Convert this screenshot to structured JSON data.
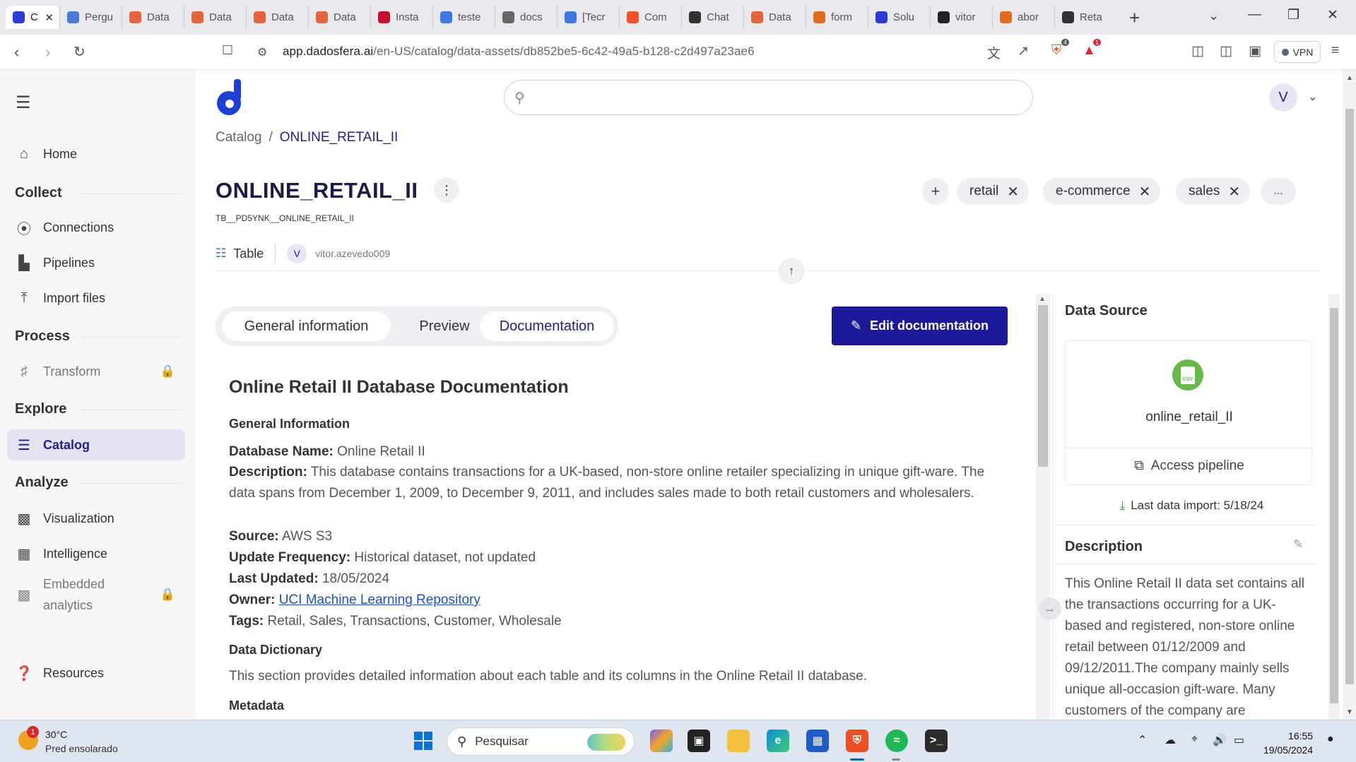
{
  "browser": {
    "tabs": [
      {
        "label": "C",
        "icon": "dadosfera-icon",
        "color": "#2c3bd6",
        "active": true
      },
      {
        "label": "Pergu",
        "icon": "doc-icon",
        "color": "#4a7bd8"
      },
      {
        "label": "Data",
        "icon": "g-icon",
        "color": "#e2633a"
      },
      {
        "label": "Data",
        "icon": "g-icon",
        "color": "#e2633a"
      },
      {
        "label": "Data",
        "icon": "g-icon",
        "color": "#e2633a"
      },
      {
        "label": "Data",
        "icon": "g-icon",
        "color": "#e2633a"
      },
      {
        "label": "Insta",
        "icon": "crown-icon",
        "color": "#c8102e"
      },
      {
        "label": "teste",
        "icon": "docs-icon",
        "color": "#3d78e0"
      },
      {
        "label": "docs",
        "icon": "globe-icon",
        "color": "#666666"
      },
      {
        "label": "[Tecr",
        "icon": "docs-icon",
        "color": "#3d78e0"
      },
      {
        "label": "Com",
        "icon": "windows-icon",
        "color": "#f25022"
      },
      {
        "label": "Chat",
        "icon": "openai-icon",
        "color": "#333333"
      },
      {
        "label": "Data",
        "icon": "g-icon",
        "color": "#e2633a"
      },
      {
        "label": "form",
        "icon": "circle-icon",
        "color": "#e06a1b"
      },
      {
        "label": "Solu",
        "icon": "dadosfera-icon",
        "color": "#2c3bd6"
      },
      {
        "label": "vitor",
        "icon": "github-icon",
        "color": "#222222"
      },
      {
        "label": "abor",
        "icon": "circle-icon",
        "color": "#e06a1b"
      },
      {
        "label": "Reta",
        "icon": "openai-icon",
        "color": "#333333"
      }
    ],
    "url_domain": "app.dadosfera.ai",
    "url_path": "/en-US/catalog/data-assets/db852be5-6c42-49a5-b128-c2d497a23ae6",
    "vpn_label": "VPN",
    "brave_badge": "4",
    "alert_badge": "1"
  },
  "sidebar": {
    "home": "Home",
    "sections": {
      "collect": "Collect",
      "process": "Process",
      "explore": "Explore",
      "analyze": "Analyze"
    },
    "items": {
      "connections": "Connections",
      "pipelines": "Pipelines",
      "import_files": "Import files",
      "transform": "Transform",
      "catalog": "Catalog",
      "visualization": "Visualization",
      "intelligence": "Intelligence",
      "embedded_1": "Embedded",
      "embedded_2": "analytics",
      "resources": "Resources"
    }
  },
  "header": {
    "avatar_initial": "V"
  },
  "breadcrumb": {
    "root": "Catalog",
    "separator": "/",
    "current": "ONLINE_RETAIL_II"
  },
  "asset": {
    "title": "ONLINE_RETAIL_II",
    "subtitle": "TB__PD5YNK__ONLINE_RETAIL_II",
    "type": "Table",
    "owner_initial": "V",
    "owner": "vitor.azevedo009",
    "tags": [
      "retail",
      "e-commerce",
      "sales"
    ],
    "tags_more": "..."
  },
  "tabs": {
    "general": "General information",
    "preview": "Preview",
    "documentation": "Documentation"
  },
  "edit_button": "Edit documentation",
  "documentation": {
    "title": "Online Retail II Database Documentation",
    "general_heading": "General Information",
    "db_name_label": "Database Name:",
    "db_name_value": "Online Retail II",
    "description_label": "Description:",
    "description_value": "This database contains transactions for a UK-based, non-store online retailer specializing in unique gift-ware. The data spans from December 1, 2009, to December 9, 2011, and includes sales made to both retail customers and wholesalers.",
    "source_label": "Source:",
    "source_value": "AWS S3",
    "update_label": "Update Frequency:",
    "update_value": "Historical dataset, not updated",
    "last_updated_label": "Last Updated:",
    "last_updated_value": "18/05/2024",
    "owner_label": "Owner:",
    "owner_value": "UCI Machine Learning Repository",
    "tags_label": "Tags:",
    "tags_value": "Retail, Sales, Transactions, Customer, Wholesale",
    "dictionary_heading": "Data Dictionary",
    "dictionary_text": "This section provides detailed information about each table and its columns in the Online Retail II database.",
    "metadata_heading": "Metadata"
  },
  "right_panel": {
    "data_source_title": "Data Source",
    "file_badge": "CSV",
    "source_name": "online_retail_II",
    "access_pipeline": "Access pipeline",
    "last_import": "Last data import: 5/18/24",
    "description_title": "Description",
    "description_text": "This Online Retail II data set contains all the transactions occurring for a UK-based and registered, non-store online retail between 01/12/2009 and 09/12/2011.The company mainly sells unique all-occasion gift-ware. Many customers of the company are"
  },
  "taskbar": {
    "weather_badge": "1",
    "temperature": "30°C",
    "weather_text": "Pred ensolarado",
    "search_placeholder": "Pesquisar",
    "time": "16:55",
    "date": "19/05/2024"
  }
}
